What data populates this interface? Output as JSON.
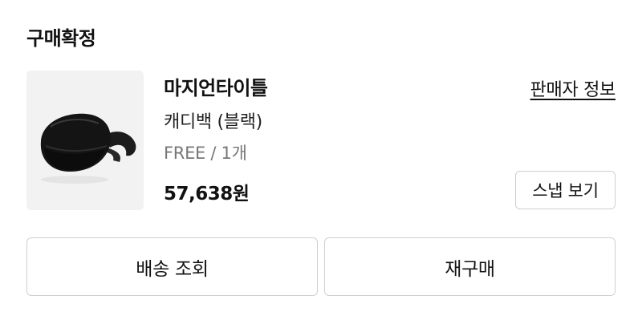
{
  "order": {
    "status": "구매확정"
  },
  "product": {
    "image_icon": "black-sling-bag-photo",
    "brand": "마지언타이틀",
    "name": "캐디백 (블랙)",
    "option": "FREE / 1개",
    "price": "57,638원"
  },
  "links": {
    "seller_info": "판매자 정보"
  },
  "buttons": {
    "snap_view": "스냅 보기",
    "delivery_lookup": "배송 조회",
    "reorder": "재구매"
  }
}
